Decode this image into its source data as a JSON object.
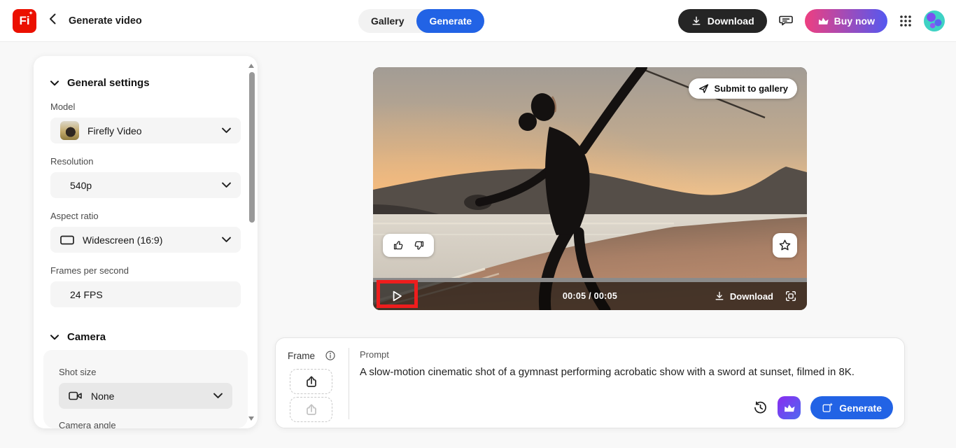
{
  "header": {
    "logo_text": "Fi",
    "title": "Generate video",
    "tabs": [
      {
        "label": "Gallery",
        "active": false
      },
      {
        "label": "Generate",
        "active": true
      }
    ],
    "download_label": "Download",
    "buy_now_label": "Buy now"
  },
  "sidebar": {
    "general": {
      "title": "General settings",
      "fields": [
        {
          "label": "Model",
          "value": "Firefly Video"
        },
        {
          "label": "Resolution",
          "value": "540p"
        },
        {
          "label": "Aspect ratio",
          "value": "Widescreen (16:9)"
        },
        {
          "label": "Frames per second",
          "value": "24 FPS"
        }
      ]
    },
    "camera": {
      "title": "Camera",
      "shot_size_label": "Shot size",
      "shot_size_value": "None",
      "camera_angle_label": "Camera angle"
    }
  },
  "video": {
    "submit_to_gallery_label": "Submit to gallery",
    "time": "00:05 / 00:05",
    "download_label": "Download"
  },
  "prompt_bar": {
    "frame_label": "Frame",
    "prompt_label": "Prompt",
    "prompt_text": "A slow-motion cinematic shot of a gymnast performing acrobatic show with a sword at sunset, filmed in 8K.",
    "generate_label": "Generate"
  },
  "icons": {
    "logo-sparkle": "✦",
    "back": "chevron-left",
    "download": "arrow-down-to-tray",
    "feedback": "speech-bubble",
    "buy-now": "crown",
    "apps": "3x3-dot-grid",
    "dropdown": "chevron-down",
    "aspect-ratio": "widescreen-rectangle",
    "shot-size": "video-camera",
    "submit": "send-arrow",
    "rate": "thumbs-up / thumbs-down",
    "favorite": "star-outline",
    "play": "triangle-outline",
    "fullscreen": "corner-brackets-square",
    "frame-info": "info-circle",
    "frame-upload": "box-arrow-up",
    "history": "clock-undo",
    "premium": "crown",
    "generate": "image-sparkle"
  },
  "colors": {
    "accent_blue": "#2263e5",
    "logo_red": "#eb1000",
    "annotation_red": "#ee1d1d",
    "buy_now_gradient_start": "#ee3f80",
    "buy_now_gradient_end": "#5458f0",
    "premium_gradient_start": "#8a2bf0",
    "premium_gradient_end": "#4e6af0",
    "avatar_teal": "#3ed2c4"
  }
}
